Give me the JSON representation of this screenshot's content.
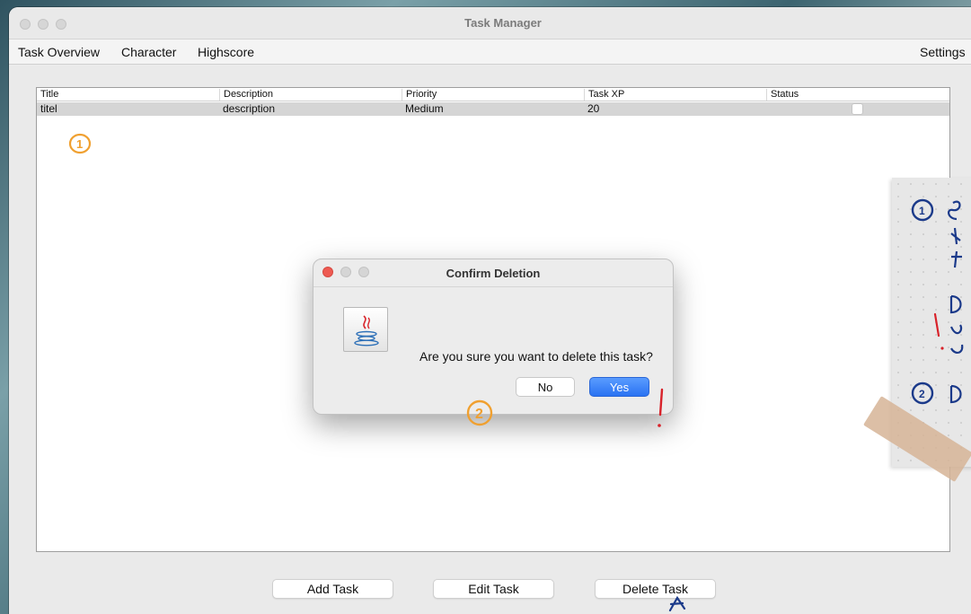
{
  "window": {
    "title": "Task Manager"
  },
  "menu": {
    "items": [
      "Task Overview",
      "Character",
      "Highscore"
    ],
    "settings": "Settings"
  },
  "table": {
    "columns": [
      "Title",
      "Description",
      "Priority",
      "Task XP",
      "Status"
    ],
    "rows": [
      {
        "title": "titel",
        "description": "description",
        "priority": "Medium",
        "xp": "20",
        "status_checked": false
      }
    ]
  },
  "buttons": {
    "add": "Add Task",
    "edit": "Edit Task",
    "delete": "Delete Task"
  },
  "dialog": {
    "title": "Confirm Deletion",
    "message": "Are you sure you want to delete this task?",
    "no_label": "No",
    "yes_label": "Yes",
    "icon": "java-icon"
  },
  "annotations": {
    "marker1": "1",
    "marker2": "2",
    "note1": "1",
    "note2": "2",
    "accent_orange": "#f0a030",
    "accent_blue": "#1b3a8a",
    "accent_red": "#d8222a"
  },
  "colors": {
    "yes_button": "#2a73f2",
    "close_red": "#ee5a52"
  }
}
